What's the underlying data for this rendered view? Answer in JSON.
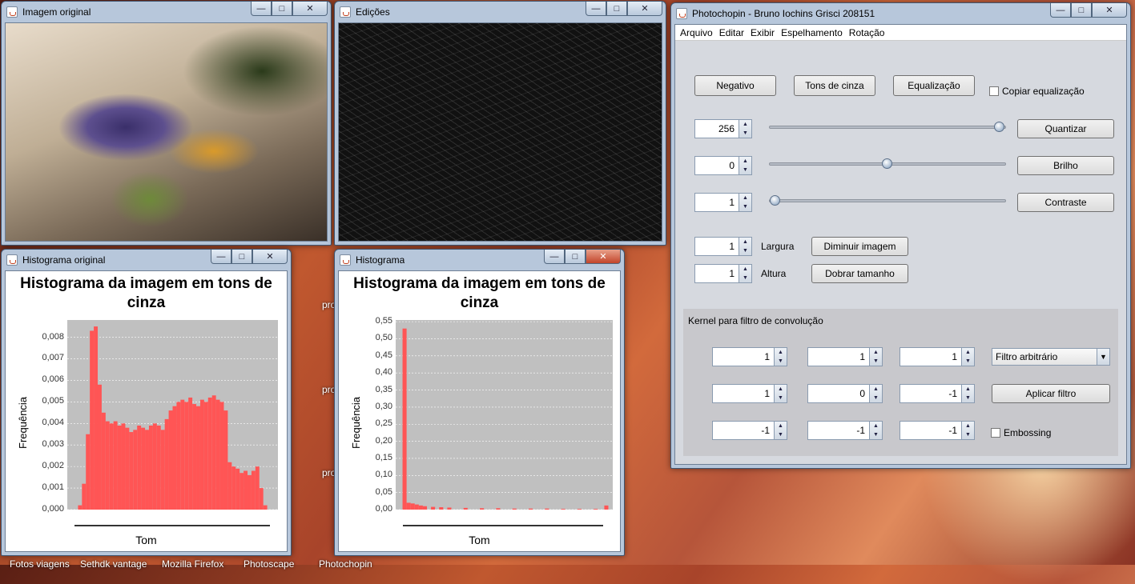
{
  "desktop": {
    "labels": [
      "pro",
      "pro",
      "pro"
    ],
    "taskbar": [
      "Fotos viagens",
      "Sethdk vantage",
      "Mozilla Firefox",
      "Photoscape",
      "Photochopin"
    ]
  },
  "win_original": {
    "title": "Imagem original",
    "min": "—",
    "max": "□",
    "close": "✕"
  },
  "win_edits": {
    "title": "Edições",
    "min": "—",
    "max": "□",
    "close": "✕"
  },
  "win_hist_original": {
    "title": "Histograma original",
    "min": "—",
    "max": "□",
    "close": "✕"
  },
  "win_hist": {
    "title": "Histograma",
    "min": "—",
    "max": "□",
    "close": "✕"
  },
  "win_main": {
    "title": "Photochopin - Bruno Iochins Grisci 208151",
    "min": "—",
    "max": "□",
    "close": "✕"
  },
  "chart_data": [
    {
      "type": "bar",
      "title": "Histograma da imagem em tons de cinza",
      "xlabel": "Tom",
      "ylabel": "Frequência",
      "ylim": [
        0,
        0.0088
      ],
      "yticks": [
        "0,008",
        "0,007",
        "0,006",
        "0,005",
        "0,004",
        "0,003",
        "0,002",
        "0,001",
        "0,000"
      ],
      "ytick_values": [
        0.008,
        0.007,
        0.006,
        0.005,
        0.004,
        0.003,
        0.002,
        0.001,
        0.0
      ],
      "xlim": [
        0,
        255
      ],
      "color": "#ff5555",
      "x": [
        5,
        10,
        15,
        20,
        25,
        30,
        35,
        40,
        45,
        50,
        55,
        60,
        65,
        70,
        75,
        80,
        85,
        90,
        95,
        100,
        105,
        110,
        115,
        120,
        125,
        130,
        135,
        140,
        145,
        150,
        155,
        160,
        165,
        170,
        175,
        180,
        185,
        190,
        195,
        200,
        205,
        210,
        215,
        220,
        225,
        230,
        235,
        240,
        245
      ],
      "values": [
        0.0,
        0.0002,
        0.0012,
        0.0035,
        0.0083,
        0.0085,
        0.0058,
        0.0045,
        0.0041,
        0.004,
        0.0041,
        0.0039,
        0.004,
        0.0038,
        0.0036,
        0.0037,
        0.0039,
        0.0038,
        0.0037,
        0.0039,
        0.004,
        0.0039,
        0.0037,
        0.0042,
        0.0046,
        0.0048,
        0.005,
        0.0051,
        0.005,
        0.0052,
        0.0049,
        0.0048,
        0.0051,
        0.005,
        0.0052,
        0.0053,
        0.0051,
        0.005,
        0.0046,
        0.0022,
        0.002,
        0.0019,
        0.0017,
        0.0018,
        0.0016,
        0.0018,
        0.002,
        0.001,
        0.0002
      ]
    },
    {
      "type": "bar",
      "title": "Histograma da imagem em tons de cinza",
      "xlabel": "Tom",
      "ylabel": "Frequência",
      "ylim": [
        0,
        0.555
      ],
      "yticks": [
        "0,55",
        "0,50",
        "0,45",
        "0,40",
        "0,35",
        "0,30",
        "0,25",
        "0,20",
        "0,15",
        "0,10",
        "0,05",
        "0,00"
      ],
      "ytick_values": [
        0.55,
        0.5,
        0.45,
        0.4,
        0.35,
        0.3,
        0.25,
        0.2,
        0.15,
        0.1,
        0.05,
        0.0
      ],
      "xlim": [
        0,
        255
      ],
      "color": "#ff5555",
      "x": [
        5,
        10,
        15,
        20,
        25,
        30,
        40,
        50,
        60,
        80,
        100,
        120,
        140,
        160,
        180,
        200,
        220,
        240,
        253
      ],
      "values": [
        0.53,
        0.02,
        0.018,
        0.015,
        0.012,
        0.01,
        0.008,
        0.007,
        0.006,
        0.005,
        0.004,
        0.004,
        0.003,
        0.003,
        0.003,
        0.002,
        0.002,
        0.002,
        0.012
      ]
    }
  ],
  "main": {
    "menu": [
      "Arquivo",
      "Editar",
      "Exibir",
      "Espelhamento",
      "Rotação"
    ],
    "btn_negative": "Negativo",
    "btn_grayscale": "Tons de cinza",
    "btn_equalize": "Equalização",
    "chk_copy_eq": "Copiar equalização",
    "quant_value": "256",
    "quant_level": 1.0,
    "btn_quantize": "Quantizar",
    "bright_value": "0",
    "bright_level": 0.5,
    "btn_brightness": "Brilho",
    "contrast_value": "1",
    "contrast_level": 0.0,
    "btn_contrast": "Contraste",
    "width_value": "1",
    "width_label": "Largura",
    "btn_shrink": "Diminuir imagem",
    "height_value": "1",
    "height_label": "Altura",
    "btn_double": "Dobrar tamanho",
    "kernel_title": "Kernel para filtro de convolução",
    "kernel": [
      [
        "1",
        "1",
        "1"
      ],
      [
        "1",
        "0",
        "-1"
      ],
      [
        "-1",
        "-1",
        "-1"
      ]
    ],
    "filter_select": "Filtro arbitrário",
    "btn_apply": "Aplicar filtro",
    "chk_emboss": "Embossing"
  }
}
